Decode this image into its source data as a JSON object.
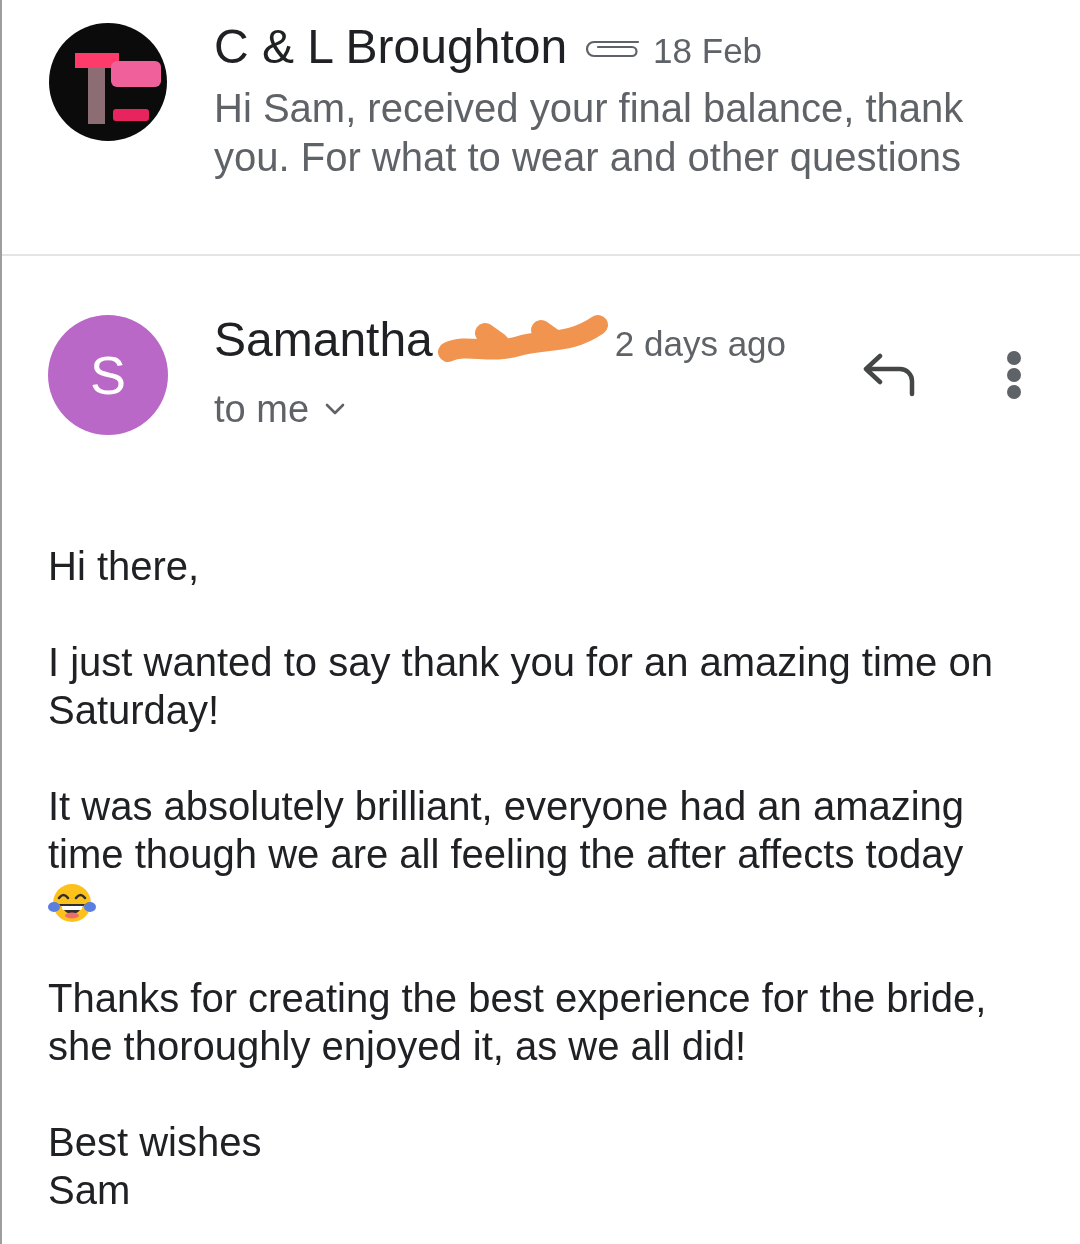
{
  "conversation": {
    "sender": "C & L Broughton",
    "attachment": true,
    "date": "18 Feb",
    "snippet": "Hi Sam, received your final balance, thank you. For what to wear and other questions"
  },
  "message": {
    "avatar_letter": "S",
    "sender": "Samantha",
    "sender_redacted": true,
    "time": "2 days ago",
    "recipient": "to me",
    "body": [
      {
        "lines": [
          {
            "kind": "text",
            "text": "Hi there,"
          }
        ]
      },
      {
        "lines": [
          {
            "kind": "text",
            "text": "I just wanted to say thank you for an amazing time on Saturday!"
          }
        ]
      },
      {
        "lines": [
          {
            "kind": "text",
            "text": "It was absolutely brilliant, everyone had an amazing time though we are all feeling the after affects today"
          },
          {
            "kind": "emoji"
          }
        ]
      },
      {
        "lines": [
          {
            "kind": "text",
            "text": "Thanks for creating the best experience for the bride, she thoroughly enjoyed it, as we all did!"
          }
        ]
      },
      {
        "lines": [
          {
            "kind": "text",
            "text": "Best wishes"
          },
          {
            "kind": "text",
            "text": "Sam"
          }
        ]
      }
    ]
  }
}
